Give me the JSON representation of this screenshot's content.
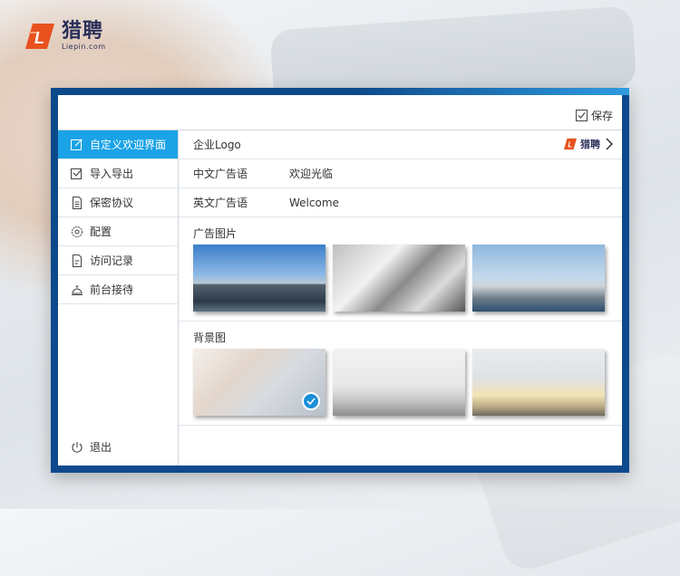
{
  "brand": {
    "name_cn": "猎聘",
    "name_en": "Liepin.com"
  },
  "toolbar": {
    "save_label": "保存"
  },
  "sidebar": {
    "items": [
      {
        "label": "自定义欢迎界面",
        "icon": "edit-icon",
        "active": true
      },
      {
        "label": "导入导出",
        "icon": "import-export-icon",
        "active": false
      },
      {
        "label": "保密协议",
        "icon": "document-icon",
        "active": false
      },
      {
        "label": "配置",
        "icon": "gear-icon",
        "active": false
      },
      {
        "label": "访问记录",
        "icon": "record-icon",
        "active": false
      },
      {
        "label": "前台接待",
        "icon": "reception-bell-icon",
        "active": false
      }
    ],
    "logout_label": "退出"
  },
  "content": {
    "logo_row": {
      "label": "企业Logo",
      "logo_text": "猎聘"
    },
    "cn_slogan": {
      "label": "中文广告语",
      "value": "欢迎光临"
    },
    "en_slogan": {
      "label": "英文广告语",
      "value": "Welcome"
    },
    "ad_images": {
      "title": "广告图片"
    },
    "background_images": {
      "title": "背景图",
      "selected_index": 0
    }
  },
  "colors": {
    "accent": "#1aa3e6",
    "frame": "#0d4a8c",
    "brand_orange": "#e8521f",
    "brand_navy": "#2a2f5a"
  }
}
